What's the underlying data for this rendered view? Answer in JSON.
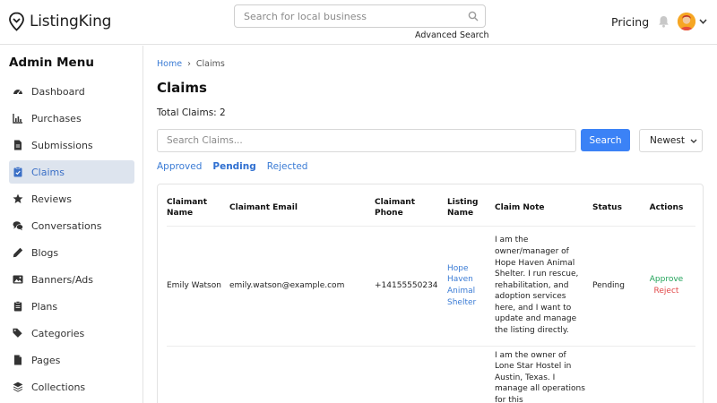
{
  "app": {
    "name": "ListingKing"
  },
  "header": {
    "search_placeholder": "Search for local business",
    "advanced_search": "Advanced Search",
    "pricing": "Pricing"
  },
  "sidebar": {
    "title": "Admin Menu",
    "items": [
      {
        "label": "Dashboard",
        "icon": "dashboard-icon"
      },
      {
        "label": "Purchases",
        "icon": "chart-icon"
      },
      {
        "label": "Submissions",
        "icon": "document-icon"
      },
      {
        "label": "Claims",
        "icon": "clipboard-check-icon",
        "active": true
      },
      {
        "label": "Reviews",
        "icon": "star-icon"
      },
      {
        "label": "Conversations",
        "icon": "chat-icon"
      },
      {
        "label": "Blogs",
        "icon": "pencil-icon"
      },
      {
        "label": "Banners/Ads",
        "icon": "image-icon"
      },
      {
        "label": "Plans",
        "icon": "clipboard-icon"
      },
      {
        "label": "Categories",
        "icon": "tags-icon"
      },
      {
        "label": "Pages",
        "icon": "page-icon"
      },
      {
        "label": "Collections",
        "icon": "layers-icon"
      }
    ]
  },
  "main": {
    "breadcrumb": {
      "home": "Home",
      "sep": "›",
      "current": "Claims"
    },
    "title": "Claims",
    "total": "Total Claims: 2",
    "search_placeholder": "Search Claims...",
    "search_button": "Search",
    "sort": "Newest",
    "tabs": [
      {
        "label": "Approved",
        "active": false
      },
      {
        "label": "Pending",
        "active": true
      },
      {
        "label": "Rejected",
        "active": false
      }
    ],
    "table": {
      "headers": [
        "Claimant Name",
        "Claimant Email",
        "Claimant Phone",
        "Listing Name",
        "Claim Note",
        "Status",
        "Actions"
      ],
      "rows": [
        {
          "name": "Emily Watson",
          "email": "emily.watson@example.com",
          "phone": "+14155550234",
          "listing": "Hope Haven Animal Shelter",
          "note": "I am the owner/manager of Hope Haven Animal Shelter. I run rescue, rehabilitation, and adoption services here, and I want to update and manage the listing directly.",
          "status": "Pending",
          "approve": "Approve",
          "reject": "Reject"
        },
        {
          "name": "",
          "email": "",
          "phone": "",
          "listing": "",
          "note": "I am the owner of Lone Star Hostel in Austin, Texas. I manage all operations for this",
          "status": "",
          "approve": "",
          "reject": ""
        }
      ]
    }
  },
  "colors": {
    "accent": "#3b82f6",
    "link": "#3a7bd5",
    "approve": "#22a35a",
    "reject": "#e14848",
    "active_nav_bg": "#dde4ee"
  }
}
